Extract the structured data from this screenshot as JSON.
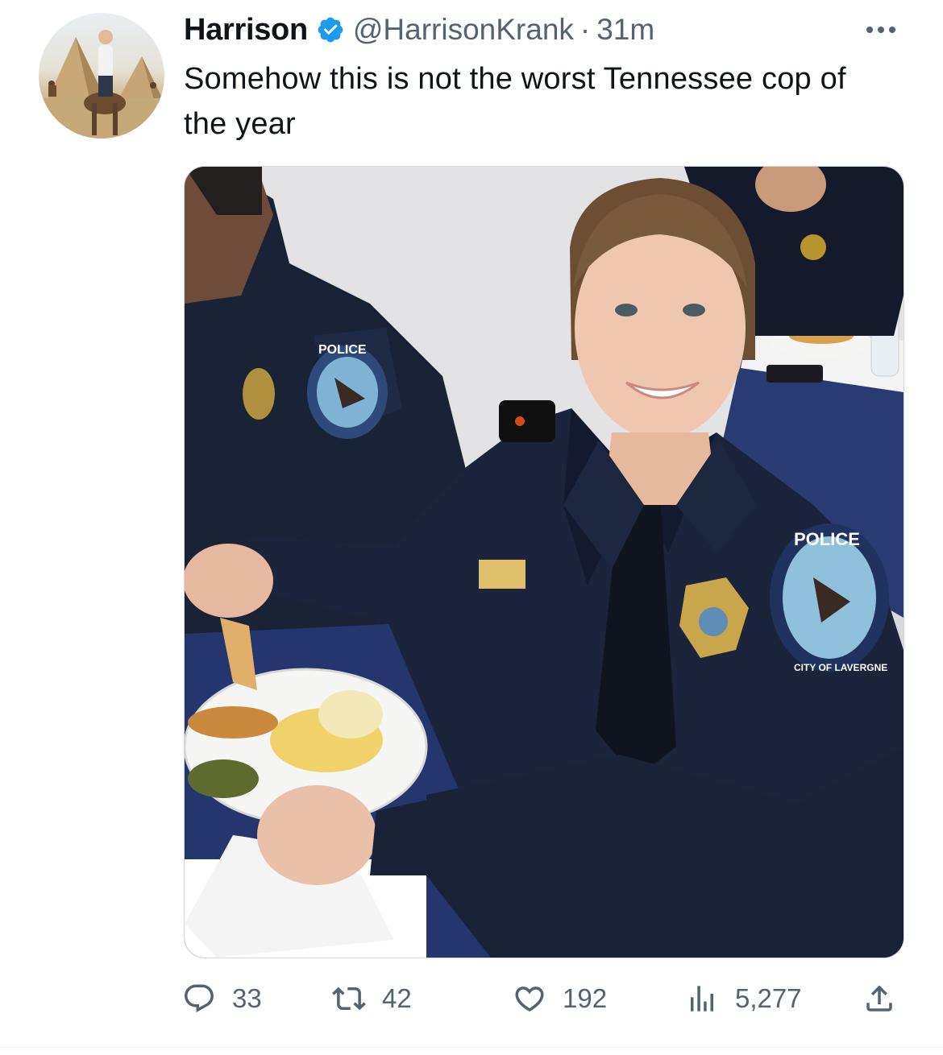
{
  "tweet": {
    "author_name": "Harrison",
    "handle": "@HarrisonKrank",
    "separator": "·",
    "time": "31m",
    "text": "Somehow this is not the worst Tennessee cop of the year",
    "verified": true,
    "accent_color": "#1d9bf0"
  },
  "icons": {
    "avatar": "avatar-icon",
    "verified": "verified-badge-icon",
    "more": "more-options-icon",
    "reply": "reply-icon",
    "retweet": "retweet-icon",
    "like": "heart-icon",
    "views": "views-chart-icon",
    "share": "share-icon"
  },
  "actions": {
    "replies": "33",
    "retweets": "42",
    "likes": "192",
    "views": "5,277"
  },
  "media": {
    "patch_text_1": "POLICE",
    "patch_text_2": "CITY OF LAVERGNE"
  }
}
